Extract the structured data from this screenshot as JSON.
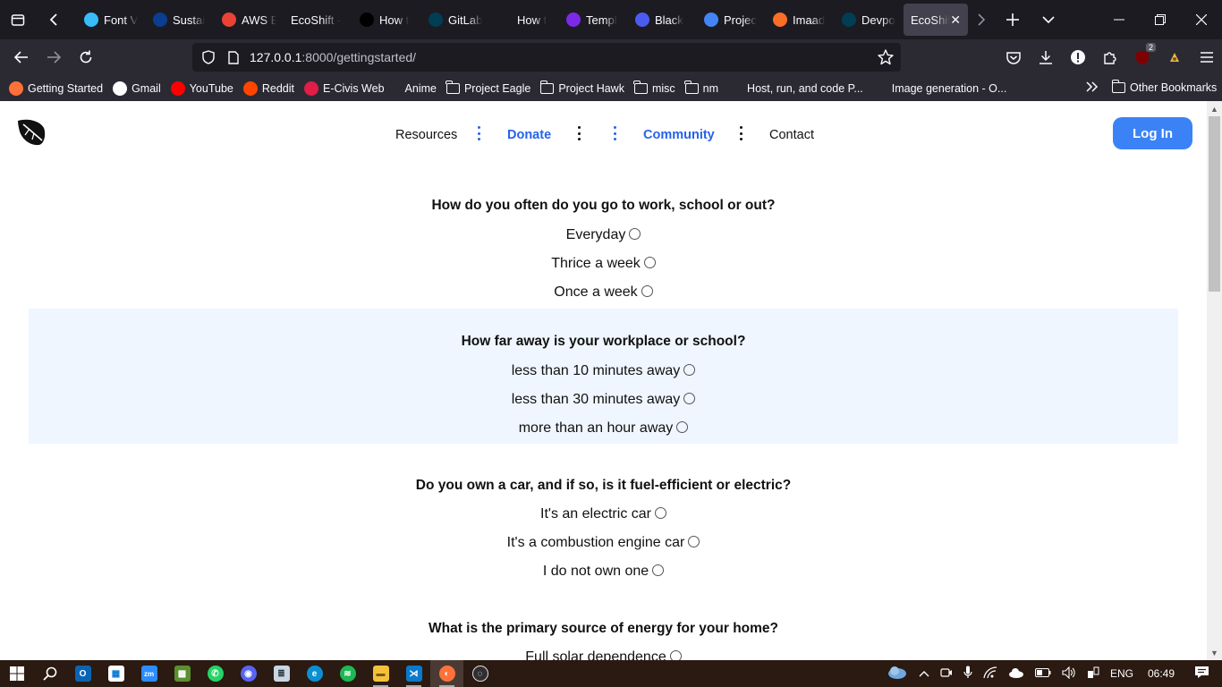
{
  "browser": {
    "tabs": [
      {
        "label": "Font V",
        "icon": "tailwind-icon",
        "color": "#38bdf8"
      },
      {
        "label": "Sustai",
        "icon": "nasa-icon",
        "color": "#0b3d91"
      },
      {
        "label": "AWS E",
        "icon": "gmail-icon",
        "color": "#ea4335"
      },
      {
        "label": "EcoShift -",
        "icon": "none",
        "color": "#1c1b22"
      },
      {
        "label": "How t",
        "icon": "medium-icon",
        "color": "#000000"
      },
      {
        "label": "GitLab",
        "icon": "devpost-d-icon",
        "color": "#003e54"
      },
      {
        "label": "How t",
        "icon": "codecademy-icon",
        "color": "#1c1b22"
      },
      {
        "label": "Templ",
        "icon": "canva-icon",
        "color": "#7d2ae8"
      },
      {
        "label": "Black",
        "icon": "canva-icon",
        "color": "#4a5cf0"
      },
      {
        "label": "Projec",
        "icon": "google-docs-icon",
        "color": "#4285f4"
      },
      {
        "label": "Imaad",
        "icon": "gitlab-icon",
        "color": "#fc6d26"
      },
      {
        "label": "Devpo",
        "icon": "devpost-d-icon",
        "color": "#003e54"
      },
      {
        "label": "EcoShif",
        "icon": "none",
        "color": "#42414d",
        "active": true
      }
    ],
    "url_host": "127.0.0.1",
    "url_rest": ":8000/gettingstarted/",
    "extension_badge": "2",
    "bookmarks": [
      {
        "label": "Getting Started",
        "icon": "firefox-icon",
        "color": "#ff7139"
      },
      {
        "label": "Gmail",
        "icon": "google-icon",
        "color": "#ffffff"
      },
      {
        "label": "YouTube",
        "icon": "youtube-icon",
        "color": "#ff0000"
      },
      {
        "label": "Reddit",
        "icon": "reddit-icon",
        "color": "#ff4500"
      },
      {
        "label": "E-Civis Web",
        "icon": "ecivis-icon",
        "color": "#e11d48"
      },
      {
        "label": "Anime",
        "icon": "none",
        "color": "#2b2a33"
      },
      {
        "label": "Project Eagle",
        "icon": "folder-icon",
        "color": "#2b2a33"
      },
      {
        "label": "Project Hawk",
        "icon": "folder-icon",
        "color": "#2b2a33"
      },
      {
        "label": "misc",
        "icon": "folder-icon",
        "color": "#2b2a33"
      },
      {
        "label": "nm",
        "icon": "folder-icon",
        "color": "#2b2a33"
      },
      {
        "label": "Host, run, and code P...",
        "icon": "replit-icon",
        "color": "#2b2a33"
      },
      {
        "label": "Image generation - O...",
        "icon": "openai-icon",
        "color": "#2b2a33"
      }
    ],
    "other_bookmarks": "Other Bookmarks"
  },
  "site": {
    "nav": {
      "resources": "Resources",
      "donate": "Donate",
      "community": "Community",
      "contact": "Contact"
    },
    "login_label": "Log In",
    "accent": "#3b82f6",
    "link_accent": "#2563eb",
    "shade": "#eff6ff"
  },
  "questions": [
    {
      "title": "How do you often do you go to work, school or out?",
      "options": [
        "Everyday",
        "Thrice a week",
        "Once a week"
      ]
    },
    {
      "title": "How far away is your workplace or school?",
      "options": [
        "less than 10 minutes away",
        "less than 30 minutes away",
        "more than an hour away"
      ]
    },
    {
      "title": "Do you own a car, and if so, is it fuel-efficient or electric?",
      "options": [
        "It's an electric car",
        "It's a combustion engine car",
        "I do not own one"
      ]
    },
    {
      "title": "What is the primary source of energy for your home?",
      "options": [
        "Full solar dependence"
      ]
    }
  ],
  "taskbar": {
    "language": "ENG",
    "time": "06:49"
  }
}
